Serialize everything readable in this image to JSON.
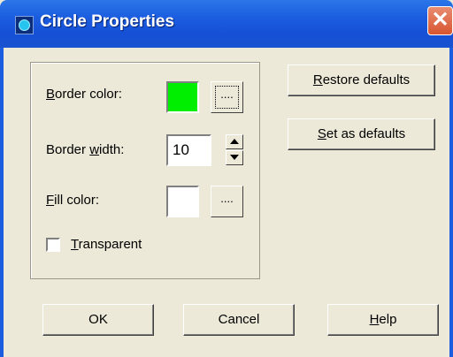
{
  "window": {
    "title": "Circle Properties",
    "close_glyph": "✕",
    "accent": "#1c5ee0"
  },
  "icons": {
    "app": "circle-app-icon",
    "close": "close-icon",
    "spin_up": "spin-up-icon",
    "spin_down": "spin-down-icon"
  },
  "form": {
    "border_color": {
      "label_key": "B",
      "label_rest": "order color:",
      "swatch_color": "#00ee00",
      "picker_label": "...."
    },
    "border_width": {
      "label_pre": "Border ",
      "label_key": "w",
      "label_rest": "idth:",
      "value": "10"
    },
    "fill_color": {
      "label_key": "F",
      "label_rest": "ill color:",
      "swatch_color": "#ffffff",
      "picker_label": "...."
    },
    "transparent": {
      "label_key": "T",
      "label_rest": "ransparent",
      "checked": false
    }
  },
  "side_buttons": {
    "restore": {
      "key": "R",
      "rest": "estore defaults"
    },
    "set_defaults": {
      "key": "S",
      "rest": "et as defaults"
    }
  },
  "bottom_buttons": {
    "ok": "OK",
    "cancel": "Cancel",
    "help_key": "H",
    "help_rest": "elp"
  }
}
